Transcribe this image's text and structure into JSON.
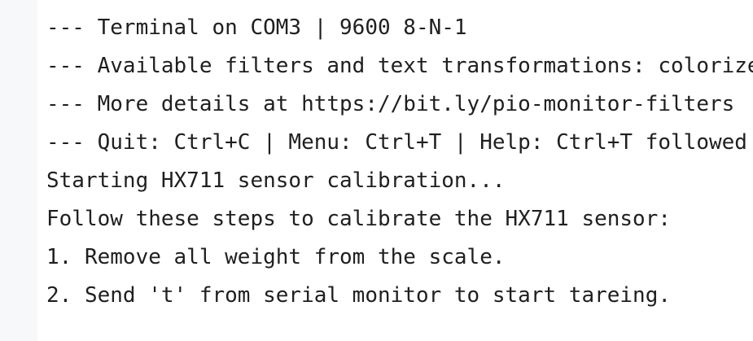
{
  "terminal": {
    "lines": [
      "--- Terminal on COM3 | 9600 8-N-1",
      "--- Available filters and text transformations: colorize",
      "--- More details at https://bit.ly/pio-monitor-filters",
      "--- Quit: Ctrl+C | Menu: Ctrl+T | Help: Ctrl+T followed",
      "Starting HX711 sensor calibration...",
      "Follow these steps to calibrate the HX711 sensor:",
      "1. Remove all weight from the scale.",
      "2. Send 't' from serial monitor to start tareing."
    ]
  },
  "colors": {
    "background": "#ffffff",
    "gutter": "#f7f8fa",
    "text": "#1f1f1f"
  }
}
